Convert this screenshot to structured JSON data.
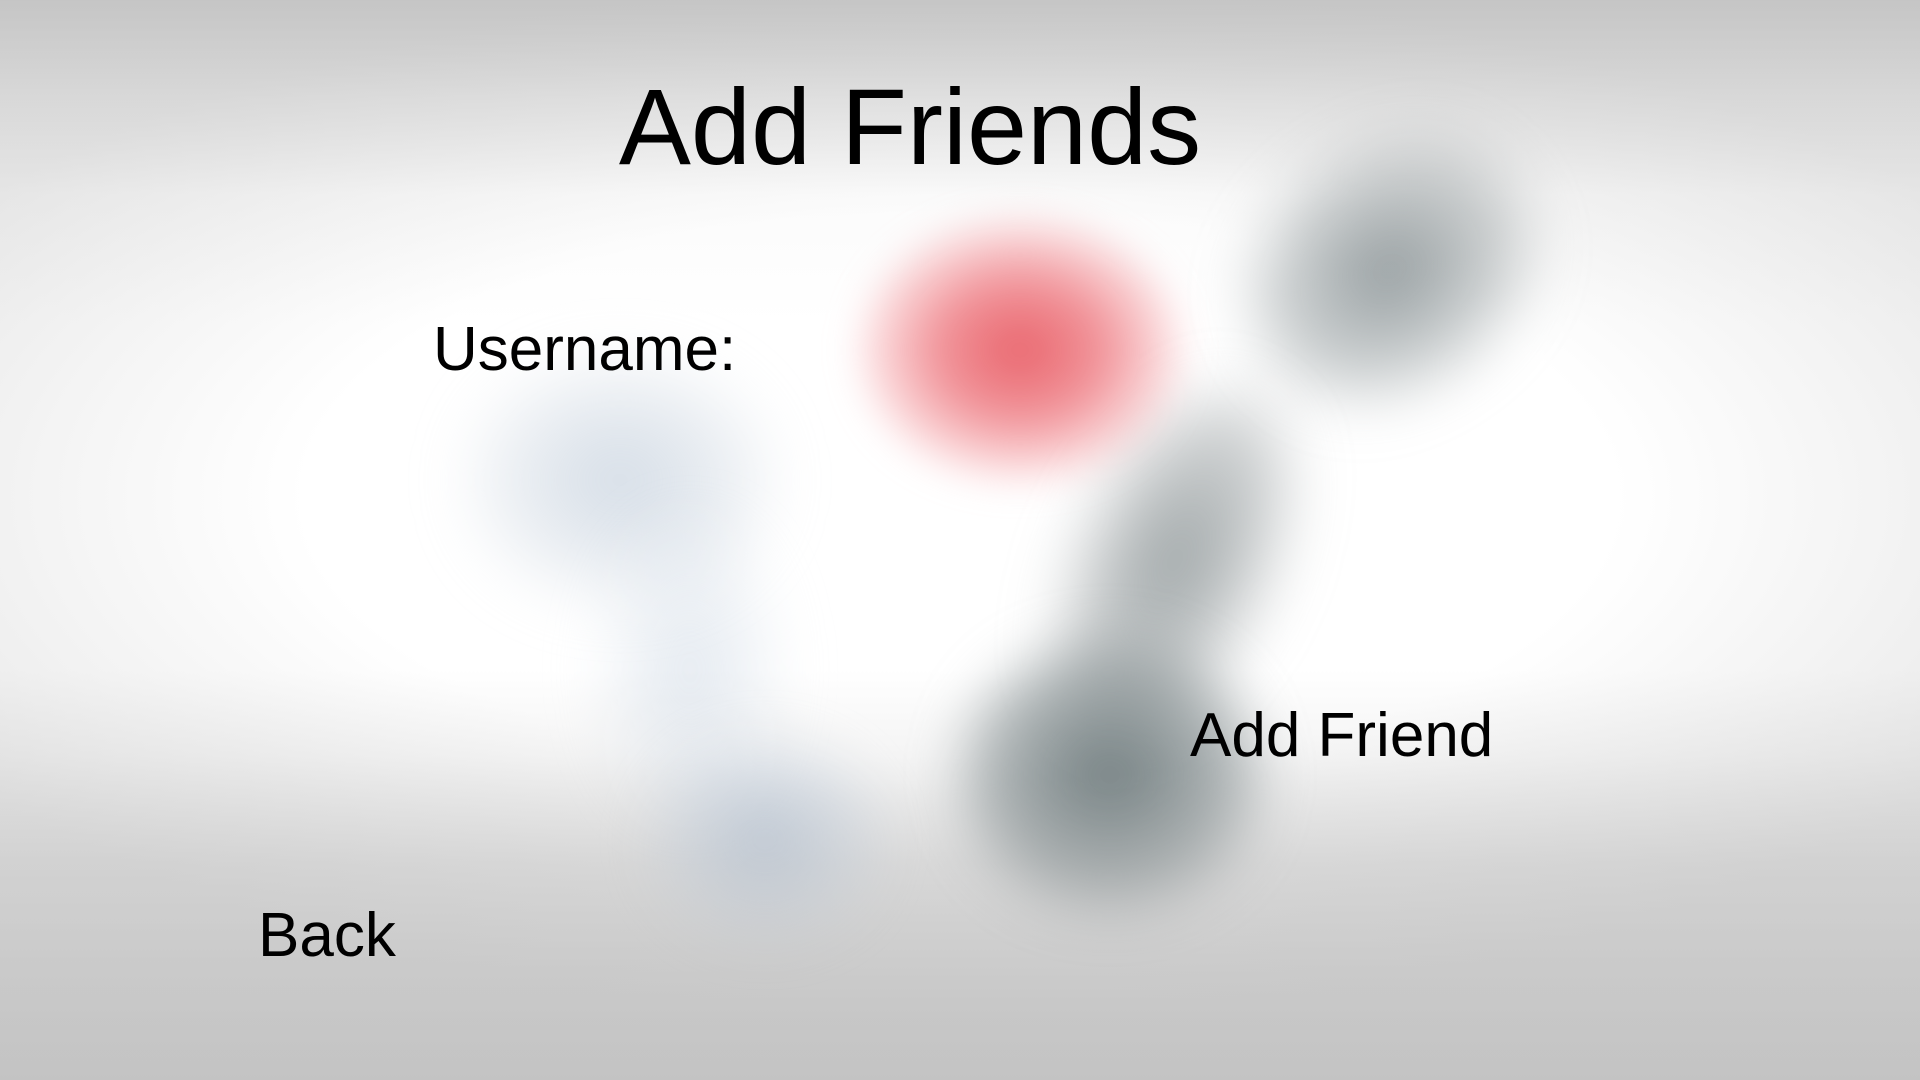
{
  "page": {
    "title": "Add Friends"
  },
  "form": {
    "username_label": "Username:",
    "username_value": "",
    "add_friend_label": "Add Friend"
  },
  "navigation": {
    "back_label": "Back"
  },
  "theme": {
    "text_color": "#000000",
    "blob_red": "#e85c64",
    "blob_dark": "#697678",
    "blob_blue": "#afbed0"
  }
}
